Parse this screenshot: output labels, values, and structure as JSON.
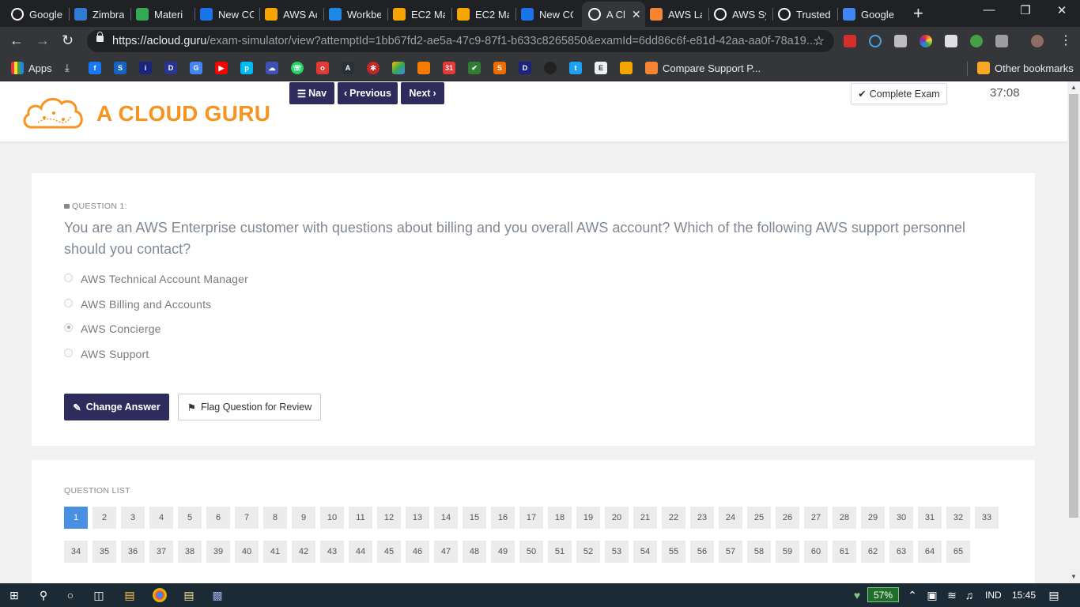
{
  "browser": {
    "tabs": [
      {
        "title": "Google",
        "icon": "google-icon",
        "color": "#ffffff"
      },
      {
        "title": "Zimbra",
        "icon": "zimbra-icon",
        "color": "#2f7bd6"
      },
      {
        "title": "Materi",
        "icon": "google-drive-icon",
        "color": "#34a853"
      },
      {
        "title": "New CC",
        "icon": "contact-icon",
        "color": "#1a73e8"
      },
      {
        "title": "AWS Ac",
        "icon": "aws-box-icon",
        "color": "#f7a600"
      },
      {
        "title": "Workbe",
        "icon": "v-icon",
        "color": "#1e88e5"
      },
      {
        "title": "EC2 Ma",
        "icon": "aws-box-icon",
        "color": "#f7a600"
      },
      {
        "title": "EC2 Ma",
        "icon": "aws-box-icon",
        "color": "#f7a600"
      },
      {
        "title": "New CC",
        "icon": "contact-icon",
        "color": "#1a73e8"
      },
      {
        "title": "A Cl",
        "icon": "acloudguru-icon",
        "color": "#ffffff",
        "active": true
      },
      {
        "title": "AWS La",
        "icon": "aws-lambda-icon",
        "color": "#f58534"
      },
      {
        "title": "AWS Sy",
        "icon": "google-icon",
        "color": "#ffffff"
      },
      {
        "title": "Trusted",
        "icon": "google-icon",
        "color": "#ffffff"
      },
      {
        "title": "Google",
        "icon": "google-translate-icon",
        "color": "#4285f4"
      }
    ],
    "url_host": "https://acloud.guru",
    "url_path": "/exam-simulator/view?attemptId=1bb67fd2-ae5a-47c9-87f1-b633c8265850&examId=6dd86c6f-e81d-42aa-aa0f-78a19...",
    "bookmarks": {
      "apps_label": "Apps",
      "compare_label": "Compare Support P...",
      "other_label": "Other bookmarks"
    }
  },
  "header": {
    "logo_text": "A CLOUD GURU",
    "nav_label": "Nav",
    "previous_label": "Previous",
    "next_label": "Next",
    "complete_label": "Complete Exam",
    "timer": "37:08"
  },
  "question": {
    "label": "QUESTION 1:",
    "text": "You are an AWS Enterprise customer with questions about billing and you overall AWS account? Which of the following AWS support personnel should you contact?",
    "options": [
      {
        "label": "AWS Technical Account Manager",
        "selected": false
      },
      {
        "label": "AWS Billing and Accounts",
        "selected": false
      },
      {
        "label": "AWS Concierge",
        "selected": true
      },
      {
        "label": "AWS Support",
        "selected": false
      }
    ],
    "change_answer_label": "Change Answer",
    "flag_label": "Flag Question for Review"
  },
  "question_list": {
    "label": "QUESTION LIST",
    "current": 1,
    "numbers": [
      "1",
      "2",
      "3",
      "4",
      "5",
      "6",
      "7",
      "8",
      "9",
      "10",
      "11",
      "12",
      "13",
      "14",
      "15",
      "16",
      "17",
      "18",
      "19",
      "20",
      "21",
      "22",
      "23",
      "24",
      "25",
      "26",
      "27",
      "28",
      "29",
      "30",
      "31",
      "32",
      "33",
      "34",
      "35",
      "36",
      "37",
      "38",
      "39",
      "40",
      "41",
      "42",
      "43",
      "44",
      "45",
      "46",
      "47",
      "48",
      "49",
      "50",
      "51",
      "52",
      "53",
      "54",
      "55",
      "56",
      "57",
      "58",
      "59",
      "60",
      "61",
      "62",
      "63",
      "64",
      "65"
    ]
  },
  "taskbar": {
    "battery": "57%",
    "language": "IND",
    "time": "15:45"
  },
  "colors": {
    "brand_orange": "#f7931e",
    "brand_navy": "#2d2c5c",
    "current_blue": "#4a90e2"
  }
}
